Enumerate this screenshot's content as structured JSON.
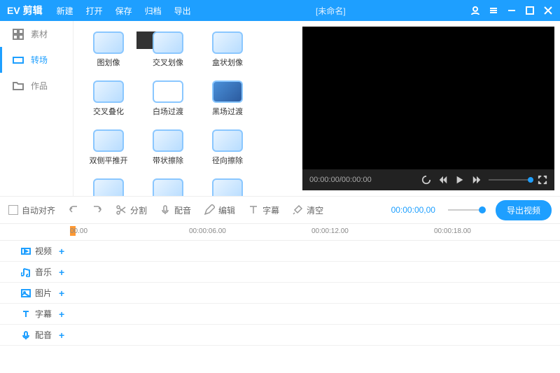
{
  "header": {
    "logo": "EV 剪辑",
    "menu": [
      "新建",
      "打开",
      "保存",
      "归档",
      "导出"
    ],
    "title": "[未命名]"
  },
  "sidebar": {
    "items": [
      {
        "label": "素材"
      },
      {
        "label": "转场"
      },
      {
        "label": "作品"
      }
    ]
  },
  "transitions": [
    {
      "label": "图划像"
    },
    {
      "label": "交叉划像"
    },
    {
      "label": "盒状划像"
    },
    {
      "label": "交叉叠化"
    },
    {
      "label": "白场过渡"
    },
    {
      "label": "黑场过渡"
    },
    {
      "label": "双侧平推开"
    },
    {
      "label": "带状擦除"
    },
    {
      "label": "径向擦除"
    },
    {
      "label": ""
    },
    {
      "label": ""
    },
    {
      "label": ""
    }
  ],
  "preview": {
    "time": "00:00:00/00:00:00"
  },
  "toolbar": {
    "align": "自动对齐",
    "split": "分割",
    "dub": "配音",
    "edit": "编辑",
    "subtitle": "字幕",
    "clear": "清空",
    "timecode": "00:00:00,00",
    "export": "导出视频"
  },
  "ruler": [
    {
      "pos": 100,
      "label": "00.00"
    },
    {
      "pos": 270,
      "label": "00:00:06.00"
    },
    {
      "pos": 445,
      "label": "00:00:12.00"
    },
    {
      "pos": 620,
      "label": "00:00:18.00"
    }
  ],
  "tracks": [
    {
      "label": "视频"
    },
    {
      "label": "音乐"
    },
    {
      "label": "图片"
    },
    {
      "label": "字幕"
    },
    {
      "label": "配音"
    }
  ]
}
